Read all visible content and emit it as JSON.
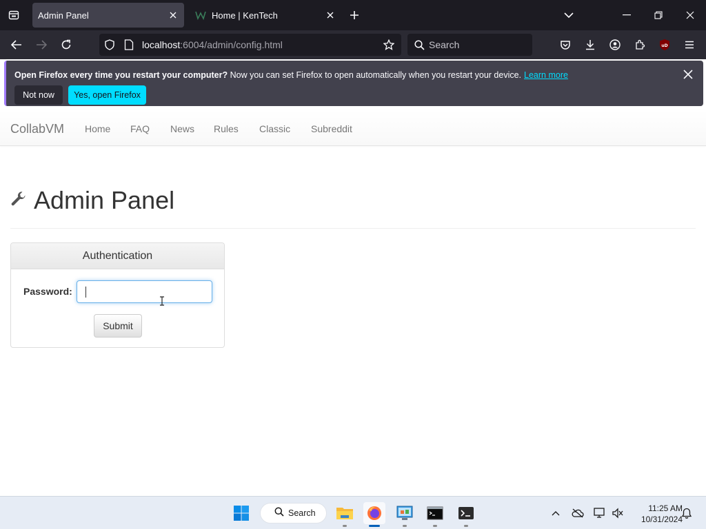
{
  "browser": {
    "tabs": [
      {
        "title": "Admin Panel",
        "active": true
      },
      {
        "title": "Home | KenTech",
        "active": false
      }
    ],
    "url": {
      "host": "localhost",
      "rest": ":6004/admin/config.html"
    },
    "search_placeholder": "Search",
    "extension_badge": "uD",
    "notification": {
      "bold": "Open Firefox every time you restart your computer?",
      "message": " Now you can set Firefox to open automatically when you restart your device.",
      "link": "Learn more",
      "secondary_button": "Not now",
      "primary_button": "Yes, open Firefox"
    }
  },
  "site": {
    "brand": "CollabVM",
    "nav": [
      "Home",
      "FAQ",
      "News",
      "Rules",
      "Classic",
      "Subreddit"
    ]
  },
  "page": {
    "title": "Admin Panel",
    "panel": {
      "heading": "Authentication",
      "password_label": "Password:",
      "password_value": "",
      "submit_label": "Submit"
    }
  },
  "taskbar": {
    "search_label": "Search",
    "time": "11:25 AM",
    "date": "10/31/2024"
  },
  "colors": {
    "accent_firefox": "#00ddff",
    "win_blue": "#005fb8",
    "input_focus": "#66afe9"
  }
}
